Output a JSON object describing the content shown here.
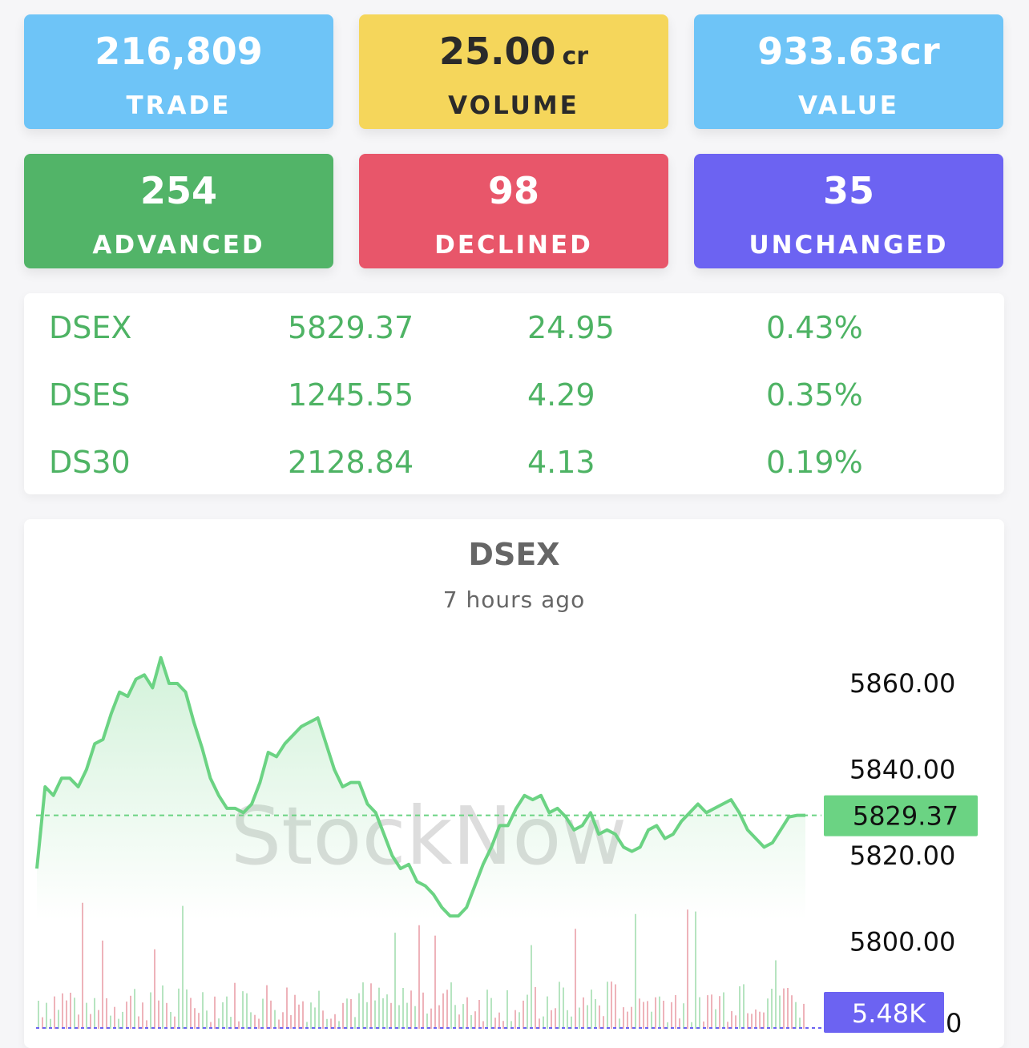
{
  "stats": {
    "trade": {
      "value": "216,809",
      "label": "TRADE",
      "color": "#6ec4f7"
    },
    "volume": {
      "value": "25.00",
      "unit": "cr",
      "label": "VOLUME",
      "color": "#f5d65b"
    },
    "value": {
      "value": "933.63cr",
      "label": "VALUE",
      "color": "#6ec4f7"
    },
    "advanced": {
      "value": "254",
      "label": "ADVANCED",
      "color": "#52b468"
    },
    "declined": {
      "value": "98",
      "label": "DECLINED",
      "color": "#e8566a"
    },
    "unchanged": {
      "value": "35",
      "label": "UNCHANGED",
      "color": "#6c63f2"
    }
  },
  "indices": [
    {
      "name": "DSEX",
      "value": "5829.37",
      "change": "24.95",
      "percent": "0.43%"
    },
    {
      "name": "DSES",
      "value": "1245.55",
      "change": "4.29",
      "percent": "0.35%"
    },
    {
      "name": "DS30",
      "value": "2128.84",
      "change": "4.13",
      "percent": "0.19%"
    }
  ],
  "chart": {
    "title": "DSEX",
    "subtitle": "7 hours ago",
    "watermark": "StockNow",
    "price_tag": "5829.37",
    "volume_tag": "5.48K",
    "volume_axis_tick": "0",
    "line_color": "#6bd383",
    "volume_tag_color": "#6c63f2"
  },
  "chart_data": {
    "type": "area",
    "ylim": [
      5785,
      5870
    ],
    "y_ticks": [
      "5860.00",
      "5840.00",
      "5820.00",
      "5800.00"
    ],
    "y_tick_values": [
      5860,
      5840,
      5820,
      5800
    ],
    "last_value": 5829.37,
    "series": [
      {
        "values": [
          5817,
          5836,
          5834,
          5838,
          5838,
          5836,
          5840,
          5846,
          5847,
          5853,
          5858,
          5857,
          5861,
          5862,
          5859,
          5866,
          5860,
          5860,
          5858,
          5851,
          5845,
          5838,
          5834,
          5831,
          5831,
          5830,
          5832,
          5837,
          5844,
          5843,
          5846,
          5848,
          5850,
          5851,
          5852,
          5846,
          5840,
          5836,
          5837,
          5837,
          5832,
          5830,
          5825,
          5820,
          5817,
          5818,
          5814,
          5813,
          5811,
          5808,
          5806,
          5806,
          5808,
          5813,
          5818,
          5822,
          5827,
          5827,
          5831,
          5834,
          5833,
          5834,
          5830,
          5831,
          5829,
          5826,
          5827,
          5830,
          5825,
          5826,
          5825,
          5822,
          5821,
          5822,
          5826,
          5827,
          5824,
          5825,
          5828,
          5830,
          5832,
          5830,
          5831,
          5832,
          5833,
          5830,
          5826,
          5824,
          5822,
          5823,
          5826,
          5829,
          5829.37,
          5829.37
        ]
      }
    ]
  }
}
